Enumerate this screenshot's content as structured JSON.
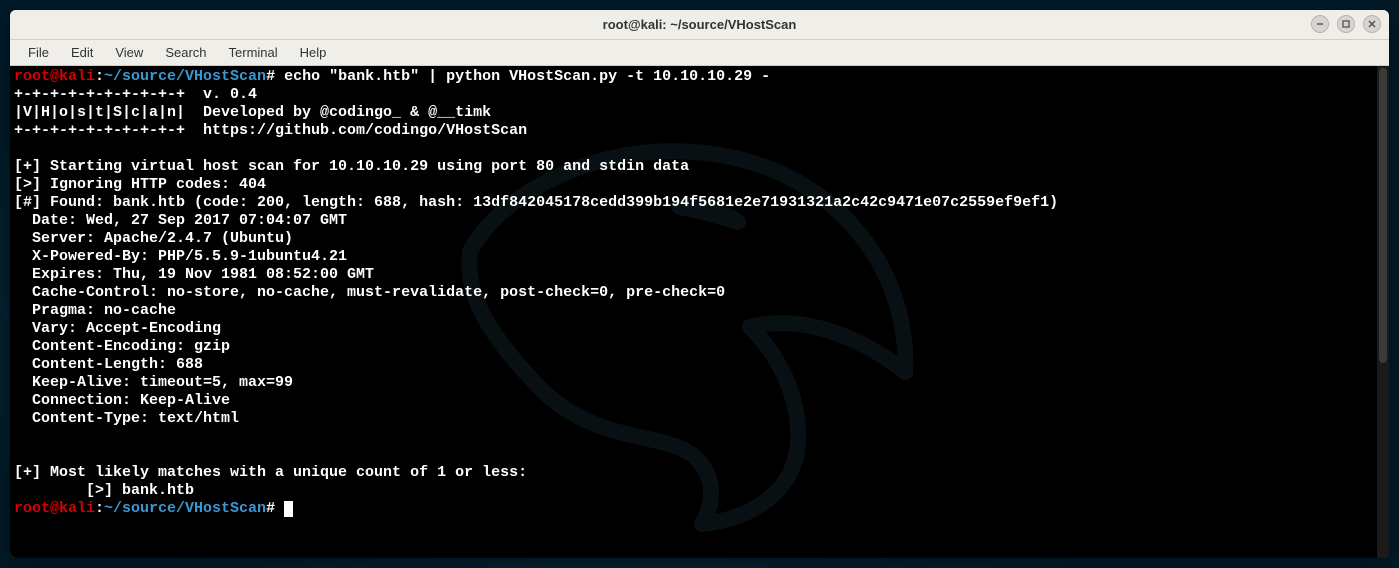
{
  "window": {
    "title": "root@kali: ~/source/VHostScan"
  },
  "menubar": {
    "items": [
      "File",
      "Edit",
      "View",
      "Search",
      "Terminal",
      "Help"
    ]
  },
  "prompt": {
    "user_host": "root@kali",
    "sep": ":",
    "path": "~/source/VHostScan",
    "hash": "#"
  },
  "command": " echo \"bank.htb\" | python VHostScan.py -t 10.10.10.29 -",
  "banner": {
    "l1": "+-+-+-+-+-+-+-+-+-+  v. 0.4",
    "l2": "|V|H|o|s|t|S|c|a|n|  Developed by @codingo_ & @__timk",
    "l3": "+-+-+-+-+-+-+-+-+-+  https://github.com/codingo/VHostScan"
  },
  "output": {
    "start": "[+] Starting virtual host scan for 10.10.10.29 using port 80 and stdin data",
    "ignoring": "[>] Ignoring HTTP codes: 404",
    "found": "[#] Found: bank.htb (code: 200, length: 688, hash: 13df842045178cedd399b194f5681e2e71931321a2c42c9471e07c2559ef9ef1)",
    "date": "  Date: Wed, 27 Sep 2017 07:04:07 GMT",
    "server": "  Server: Apache/2.4.7 (Ubuntu)",
    "xpb": "  X-Powered-By: PHP/5.5.9-1ubuntu4.21",
    "exp": "  Expires: Thu, 19 Nov 1981 08:52:00 GMT",
    "cc": "  Cache-Control: no-store, no-cache, must-revalidate, post-check=0, pre-check=0",
    "pragma": "  Pragma: no-cache",
    "vary": "  Vary: Accept-Encoding",
    "ce": "  Content-Encoding: gzip",
    "cl": "  Content-Length: 688",
    "ka": "  Keep-Alive: timeout=5, max=99",
    "conn": "  Connection: Keep-Alive",
    "ct": "  Content-Type: text/html",
    "matches": "[+] Most likely matches with a unique count of 1 or less:",
    "match1": "        [>] bank.htb"
  }
}
